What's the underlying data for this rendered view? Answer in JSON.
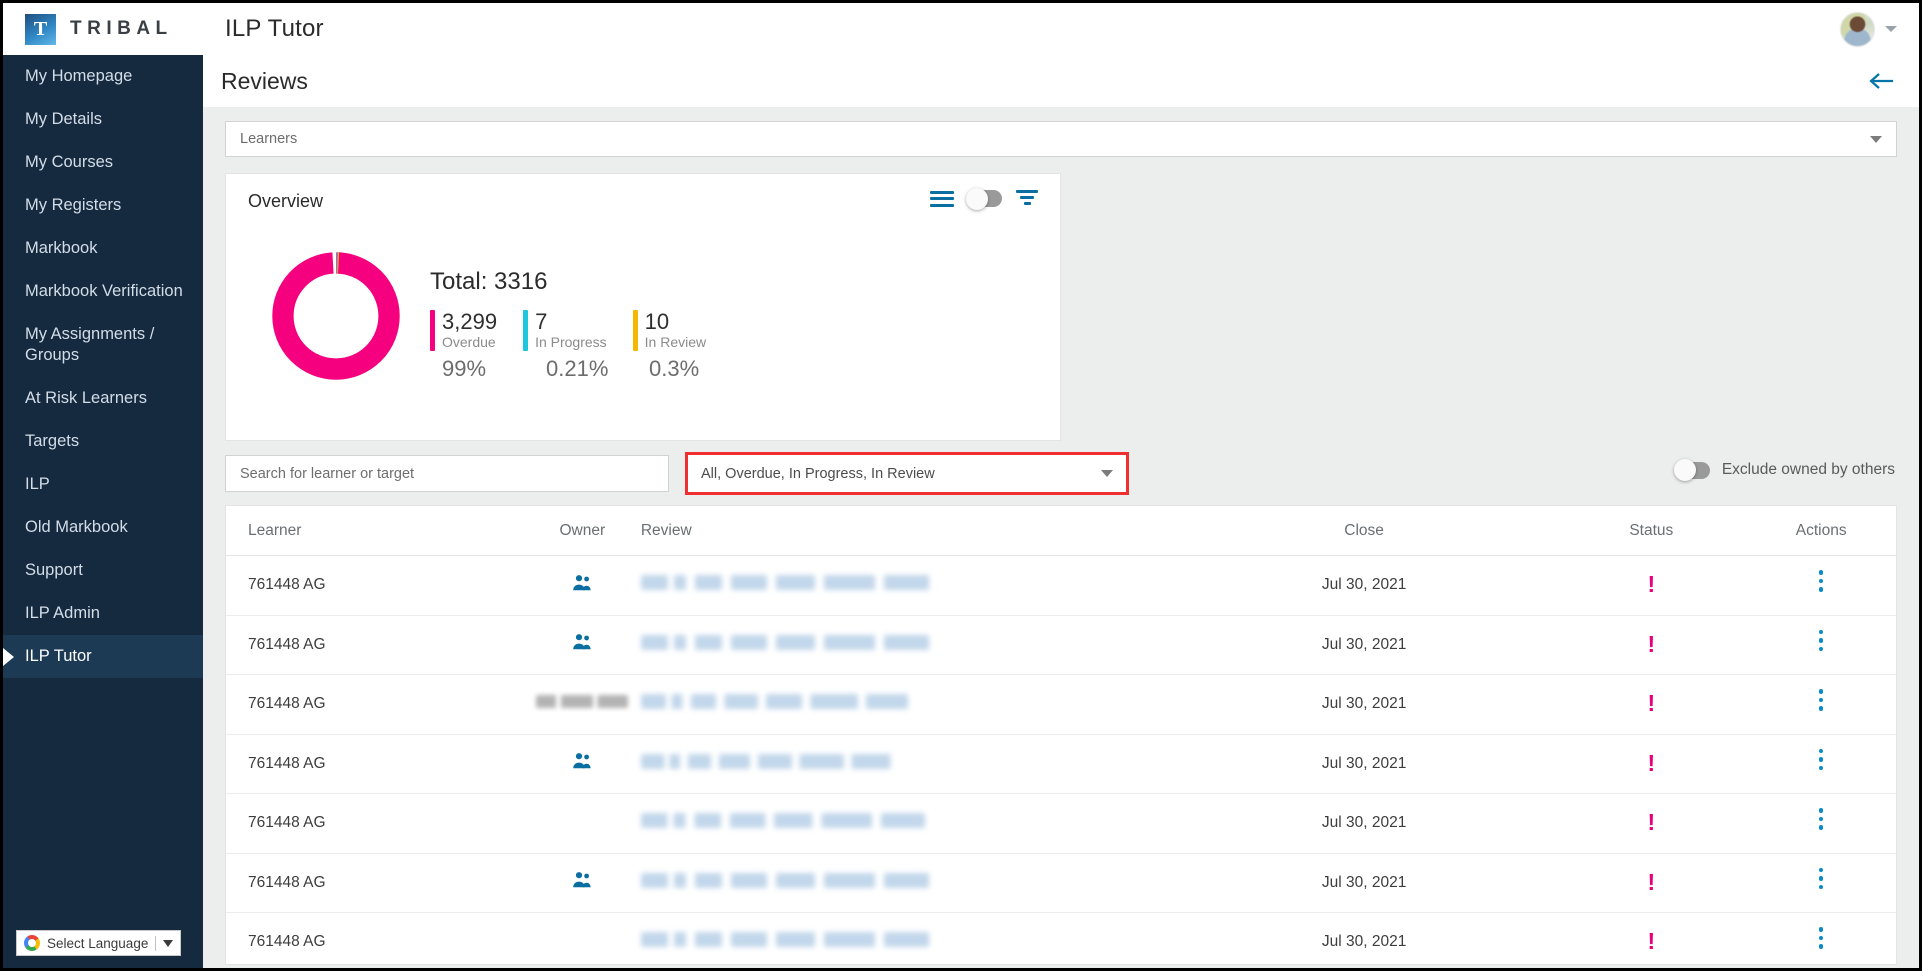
{
  "topbar": {
    "brand_mark": "T",
    "brand_text": "TRIBAL",
    "app_title": "ILP Tutor",
    "avatar_icon": "user-avatar",
    "caret_icon": "chevron-down-icon"
  },
  "sidebar": {
    "items": [
      {
        "label": "My Homepage",
        "active": false
      },
      {
        "label": "My Details",
        "active": false
      },
      {
        "label": "My Courses",
        "active": false
      },
      {
        "label": "My Registers",
        "active": false
      },
      {
        "label": "Markbook",
        "active": false
      },
      {
        "label": "Markbook Verification",
        "active": false
      },
      {
        "label": "My Assignments / Groups",
        "active": false
      },
      {
        "label": "At Risk Learners",
        "active": false
      },
      {
        "label": "Targets",
        "active": false
      },
      {
        "label": "ILP",
        "active": false
      },
      {
        "label": "Old Markbook",
        "active": false
      },
      {
        "label": "Support",
        "active": false
      },
      {
        "label": "ILP Admin",
        "active": false
      },
      {
        "label": "ILP Tutor",
        "active": true
      }
    ],
    "language_widget": {
      "label": "Select Language",
      "logo_icon": "google-logo-icon",
      "caret_icon": "caret-down-icon"
    }
  },
  "page": {
    "title": "Reviews",
    "back_icon": "arrow-left-icon"
  },
  "learners_select": {
    "value": "Learners",
    "caret_icon": "caret-down-icon"
  },
  "overview": {
    "title": "Overview",
    "hamburger_icon": "list-view-icon",
    "toggle_icon": "chart-toggle",
    "toggle_on": false,
    "filter_icon": "filter-icon",
    "total_label": "Total: 3316"
  },
  "chart_data": {
    "type": "pie",
    "title": "Overview",
    "total": 3316,
    "total_label": "Total: 3316",
    "categories": [
      "Overdue",
      "In Progress",
      "In Review"
    ],
    "values": [
      3299,
      7,
      10
    ],
    "percent_labels": [
      "99%",
      "0.21%",
      "0.3%"
    ],
    "value_labels": [
      "3,299",
      "7",
      "10"
    ],
    "colors": [
      "#f5007e",
      "#1ec8dc",
      "#f5b700"
    ],
    "donut": true,
    "legend": "right"
  },
  "filters": {
    "search_placeholder": "Search for learner or target",
    "status_value": "All, Overdue, In Progress, In Review",
    "status_caret_icon": "caret-down-icon",
    "status_highlighted": true,
    "exclude_label": "Exclude owned by others",
    "exclude_on": false
  },
  "table": {
    "columns": [
      "Learner",
      "Owner",
      "Review",
      "Close",
      "Status",
      "Actions"
    ],
    "rows": [
      {
        "learner": "761448 AG",
        "owner_icon": "people-group-icon",
        "owner_redacted": false,
        "review": "",
        "close": "Jul 30, 2021",
        "status_icon": "exclamation-icon",
        "actions_icon": "kebab-menu-icon"
      },
      {
        "learner": "761448 AG",
        "owner_icon": "people-group-icon",
        "owner_redacted": false,
        "review": "",
        "close": "Jul 30, 2021",
        "status_icon": "exclamation-icon",
        "actions_icon": "kebab-menu-icon"
      },
      {
        "learner": "761448 AG",
        "owner_icon": "",
        "owner_redacted": true,
        "review": "",
        "close": "Jul 30, 2021",
        "status_icon": "exclamation-icon",
        "actions_icon": "kebab-menu-icon"
      },
      {
        "learner": "761448 AG",
        "owner_icon": "people-group-icon",
        "owner_redacted": false,
        "review": "",
        "close": "Jul 30, 2021",
        "status_icon": "exclamation-icon",
        "actions_icon": "kebab-menu-icon"
      },
      {
        "learner": "761448 AG",
        "owner_icon": "",
        "owner_redacted": false,
        "review": "",
        "close": "Jul 30, 2021",
        "status_icon": "exclamation-icon",
        "actions_icon": "kebab-menu-icon"
      },
      {
        "learner": "761448 AG",
        "owner_icon": "people-group-icon",
        "owner_redacted": false,
        "review": "",
        "close": "Jul 30, 2021",
        "status_icon": "exclamation-icon",
        "actions_icon": "kebab-menu-icon"
      },
      {
        "learner": "761448 AG",
        "owner_icon": "",
        "owner_redacted": false,
        "review": "",
        "close": "Jul 30, 2021",
        "status_icon": "exclamation-icon",
        "actions_icon": "kebab-menu-icon"
      }
    ]
  },
  "colors": {
    "sidebar_bg": "#15293f",
    "sidebar_active": "#1d3a55",
    "accent_blue": "#0b6ea0",
    "overdue_pink": "#f5007e",
    "in_progress_cyan": "#1ec8dc",
    "in_review_yellow": "#f5b700",
    "highlight_red": "#f03030",
    "content_bg": "#eceded"
  }
}
